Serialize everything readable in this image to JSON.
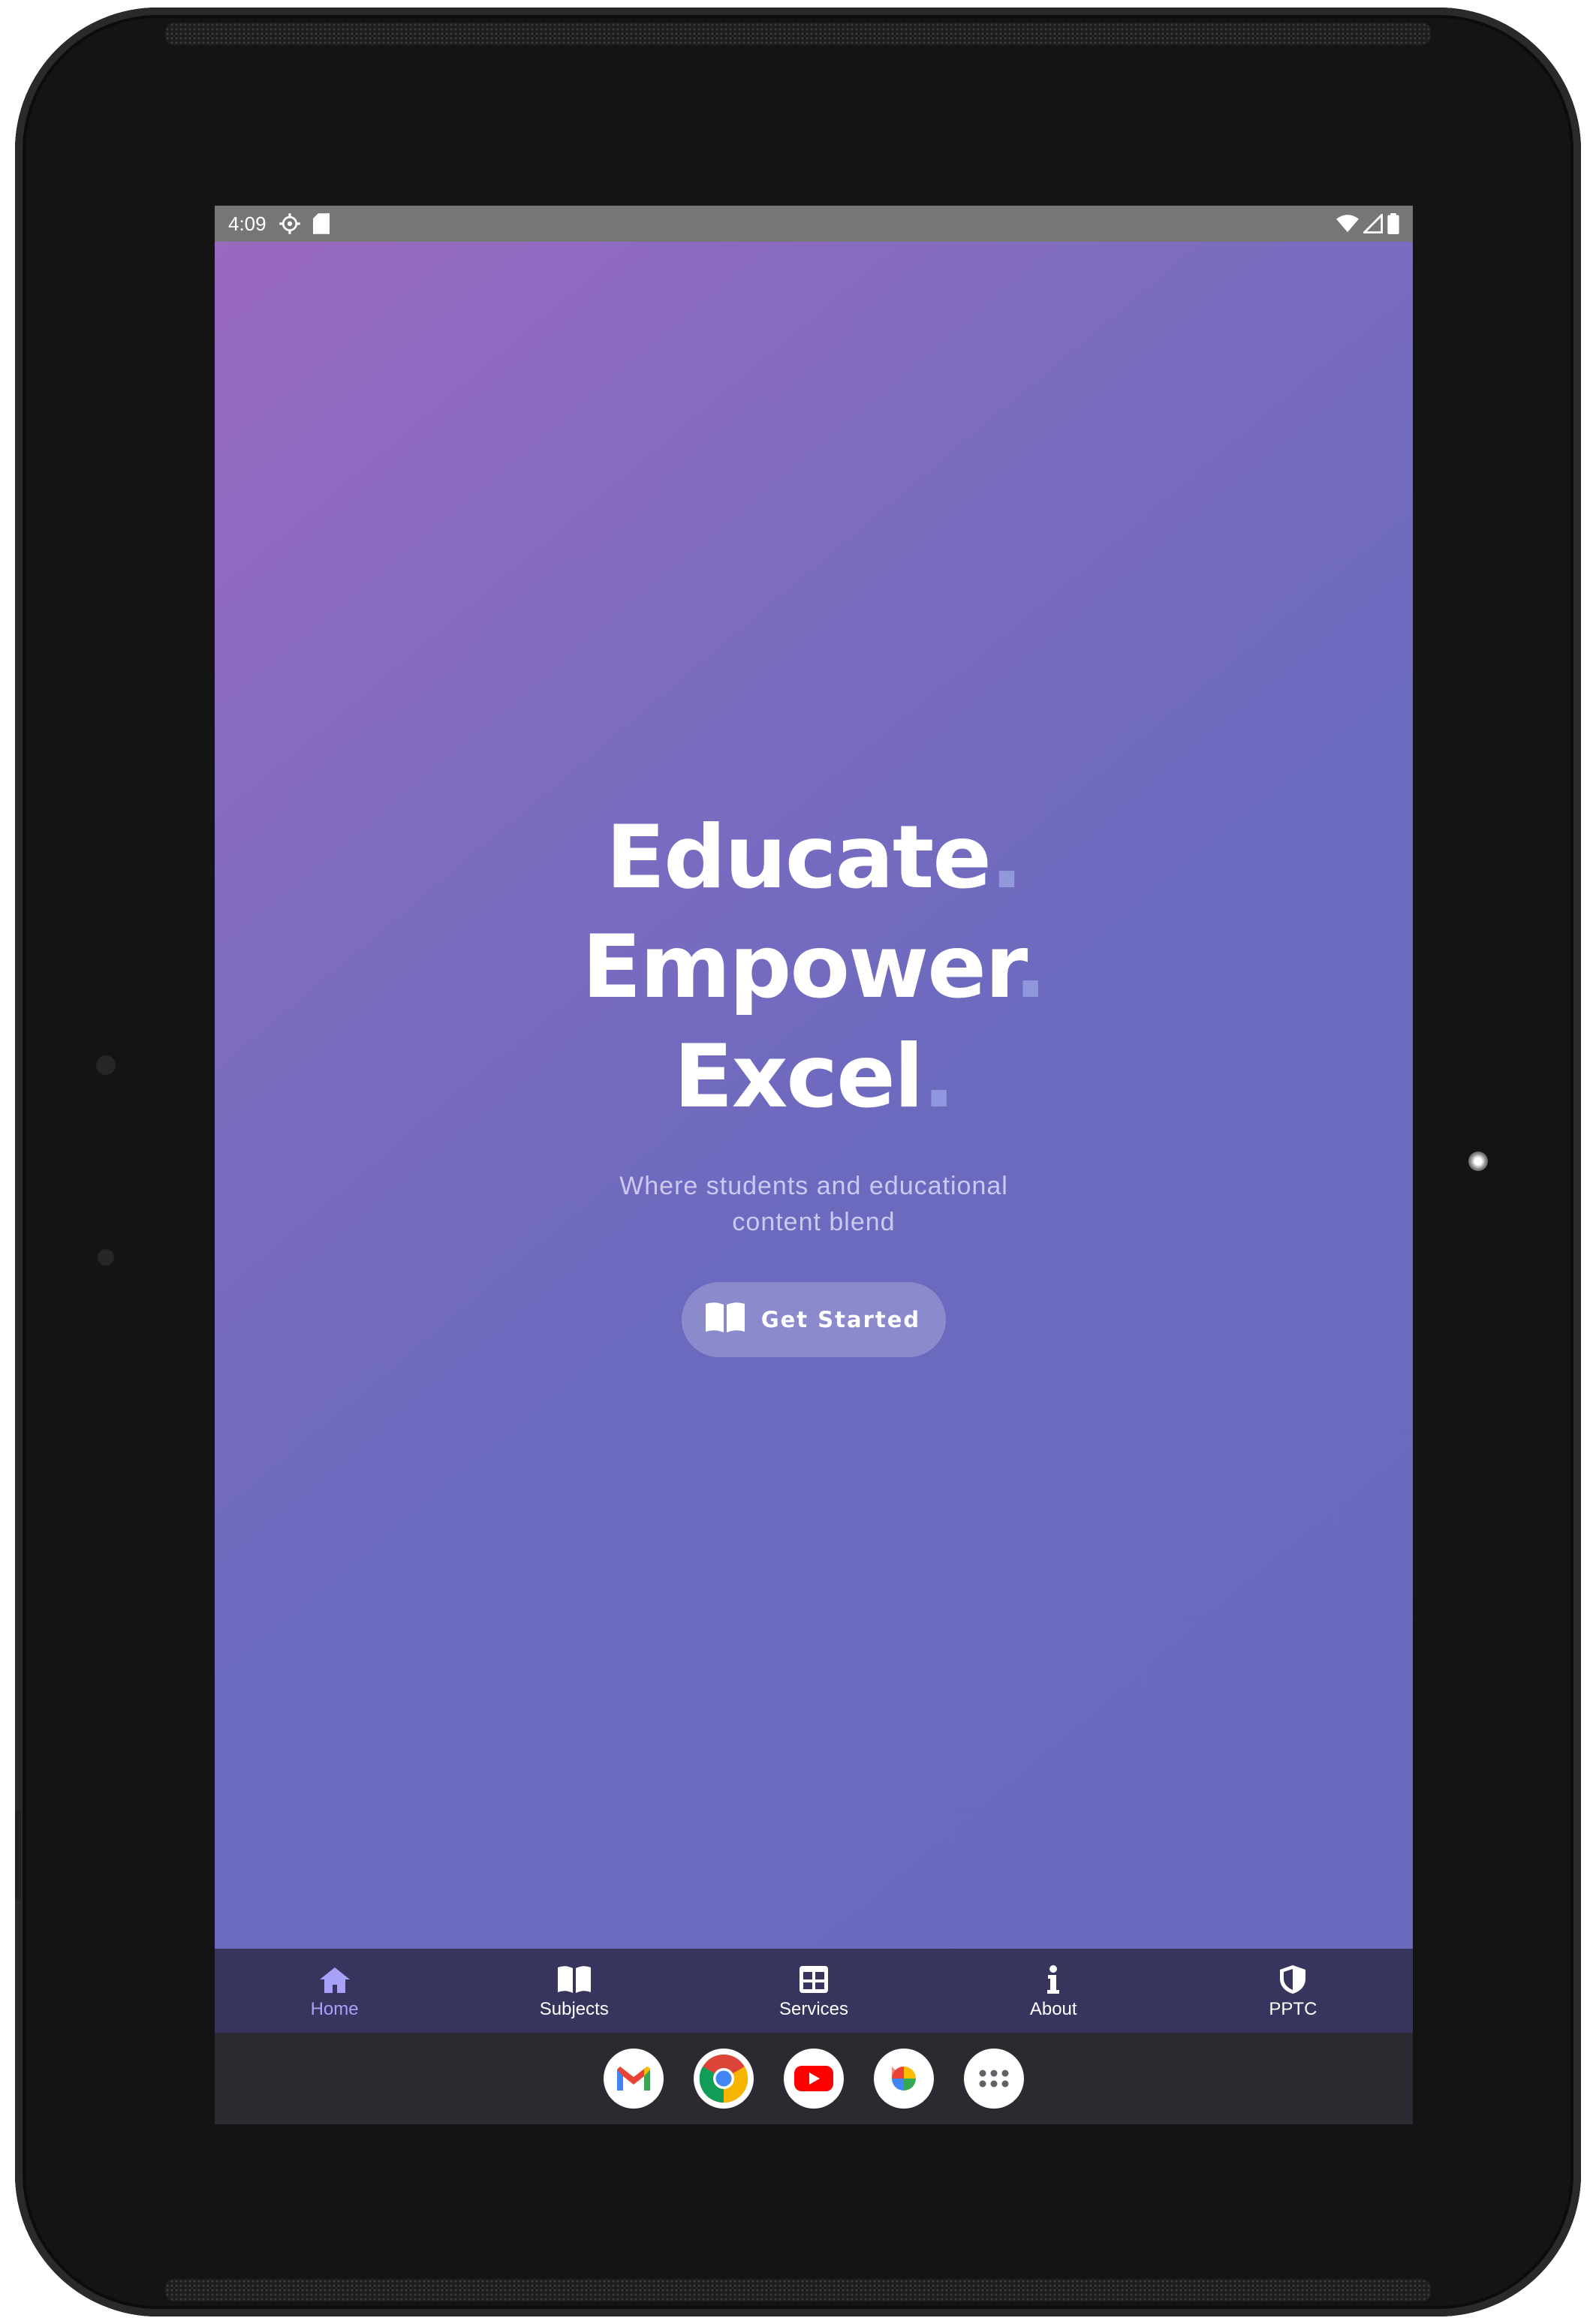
{
  "status_bar": {
    "time": "4:09",
    "left_icons": [
      "settings-gear-icon",
      "sd-card-icon"
    ],
    "right_icons": [
      "wifi-icon",
      "cell-signal-icon",
      "battery-icon"
    ]
  },
  "hero": {
    "headline_lines": [
      {
        "word": "Educate",
        "dot": "."
      },
      {
        "word": "Empower",
        "dot": "."
      },
      {
        "word": "Excel",
        "dot": "."
      }
    ],
    "tagline_line1": "Where students and educational",
    "tagline_line2": "content blend",
    "cta": {
      "label": "Get Started",
      "icon": "open-book-icon"
    }
  },
  "bottom_nav": {
    "items": [
      {
        "label": "Home",
        "icon": "home-icon",
        "active": true
      },
      {
        "label": "Subjects",
        "icon": "book-icon",
        "active": false
      },
      {
        "label": "Services",
        "icon": "table-grid-icon",
        "active": false
      },
      {
        "label": "About",
        "icon": "info-icon",
        "active": false
      },
      {
        "label": "PPTC",
        "icon": "shield-icon",
        "active": false
      }
    ]
  },
  "dock": {
    "apps": [
      "gmail-icon",
      "chrome-icon",
      "youtube-icon",
      "photos-icon",
      "app-drawer-icon"
    ]
  },
  "colors": {
    "gradient_start": "#9a69c0",
    "gradient_end": "#6a69bd",
    "nav_background": "#37345d",
    "nav_active": "#a7a2f8",
    "headline_dot": "#9ea7e6"
  }
}
